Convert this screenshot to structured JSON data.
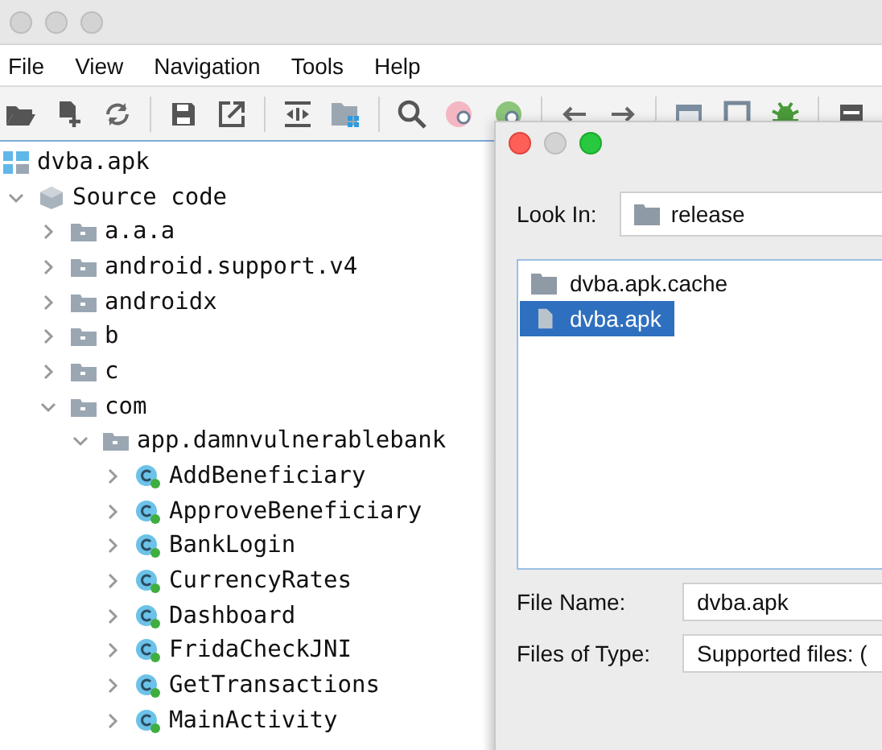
{
  "menu": [
    "File",
    "View",
    "Navigation",
    "Tools",
    "Help"
  ],
  "tree": [
    {
      "label": "dvba.apk",
      "kind": "apk",
      "children": [
        {
          "label": "Source code",
          "kind": "source",
          "expanded": true,
          "children": [
            {
              "label": "a.a.a",
              "kind": "package",
              "expanded": false
            },
            {
              "label": "android.support.v4",
              "kind": "package",
              "expanded": false
            },
            {
              "label": "androidx",
              "kind": "package",
              "expanded": false
            },
            {
              "label": "b",
              "kind": "package",
              "expanded": false
            },
            {
              "label": "c",
              "kind": "package",
              "expanded": false
            },
            {
              "label": "com",
              "kind": "package",
              "expanded": true,
              "children": [
                {
                  "label": "app.damnvulnerablebank",
                  "kind": "package",
                  "expanded": true,
                  "children": [
                    {
                      "label": "AddBeneficiary",
                      "kind": "class",
                      "expanded": false
                    },
                    {
                      "label": "ApproveBeneficiary",
                      "kind": "class",
                      "expanded": false
                    },
                    {
                      "label": "BankLogin",
                      "kind": "class",
                      "expanded": false
                    },
                    {
                      "label": "CurrencyRates",
                      "kind": "class",
                      "expanded": false
                    },
                    {
                      "label": "Dashboard",
                      "kind": "class",
                      "expanded": false
                    },
                    {
                      "label": "FridaCheckJNI",
                      "kind": "class",
                      "expanded": false
                    },
                    {
                      "label": "GetTransactions",
                      "kind": "class",
                      "expanded": false
                    },
                    {
                      "label": "MainActivity",
                      "kind": "class",
                      "expanded": false
                    }
                  ]
                }
              ]
            }
          ]
        }
      ]
    }
  ],
  "dialog": {
    "look_in_label": "Look In:",
    "look_in": "release",
    "files": [
      {
        "name": "dvba.apk.cache",
        "kind": "folder",
        "selected": false
      },
      {
        "name": "dvba.apk",
        "kind": "file",
        "selected": true
      }
    ],
    "file_name_label": "File Name:",
    "file_name": "dvba.apk",
    "type_label": "Files of Type:",
    "type": "Supported files: ("
  }
}
